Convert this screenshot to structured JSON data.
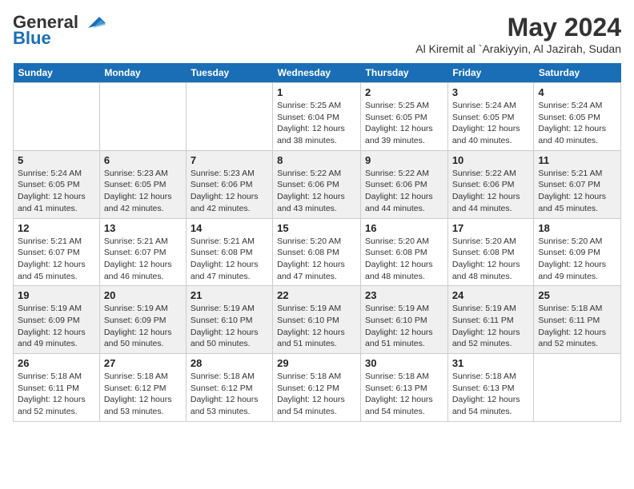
{
  "logo": {
    "line1": "General",
    "line2": "Blue"
  },
  "title": "May 2024",
  "subtitle": "Al Kiremit al `Arakiyyin, Al Jazirah, Sudan",
  "headers": [
    "Sunday",
    "Monday",
    "Tuesday",
    "Wednesday",
    "Thursday",
    "Friday",
    "Saturday"
  ],
  "weeks": [
    [
      {
        "day": "",
        "info": ""
      },
      {
        "day": "",
        "info": ""
      },
      {
        "day": "",
        "info": ""
      },
      {
        "day": "1",
        "info": "Sunrise: 5:25 AM\nSunset: 6:04 PM\nDaylight: 12 hours and 38 minutes."
      },
      {
        "day": "2",
        "info": "Sunrise: 5:25 AM\nSunset: 6:05 PM\nDaylight: 12 hours and 39 minutes."
      },
      {
        "day": "3",
        "info": "Sunrise: 5:24 AM\nSunset: 6:05 PM\nDaylight: 12 hours and 40 minutes."
      },
      {
        "day": "4",
        "info": "Sunrise: 5:24 AM\nSunset: 6:05 PM\nDaylight: 12 hours and 40 minutes."
      }
    ],
    [
      {
        "day": "5",
        "info": "Sunrise: 5:24 AM\nSunset: 6:05 PM\nDaylight: 12 hours and 41 minutes."
      },
      {
        "day": "6",
        "info": "Sunrise: 5:23 AM\nSunset: 6:05 PM\nDaylight: 12 hours and 42 minutes."
      },
      {
        "day": "7",
        "info": "Sunrise: 5:23 AM\nSunset: 6:06 PM\nDaylight: 12 hours and 42 minutes."
      },
      {
        "day": "8",
        "info": "Sunrise: 5:22 AM\nSunset: 6:06 PM\nDaylight: 12 hours and 43 minutes."
      },
      {
        "day": "9",
        "info": "Sunrise: 5:22 AM\nSunset: 6:06 PM\nDaylight: 12 hours and 44 minutes."
      },
      {
        "day": "10",
        "info": "Sunrise: 5:22 AM\nSunset: 6:06 PM\nDaylight: 12 hours and 44 minutes."
      },
      {
        "day": "11",
        "info": "Sunrise: 5:21 AM\nSunset: 6:07 PM\nDaylight: 12 hours and 45 minutes."
      }
    ],
    [
      {
        "day": "12",
        "info": "Sunrise: 5:21 AM\nSunset: 6:07 PM\nDaylight: 12 hours and 45 minutes."
      },
      {
        "day": "13",
        "info": "Sunrise: 5:21 AM\nSunset: 6:07 PM\nDaylight: 12 hours and 46 minutes."
      },
      {
        "day": "14",
        "info": "Sunrise: 5:21 AM\nSunset: 6:08 PM\nDaylight: 12 hours and 47 minutes."
      },
      {
        "day": "15",
        "info": "Sunrise: 5:20 AM\nSunset: 6:08 PM\nDaylight: 12 hours and 47 minutes."
      },
      {
        "day": "16",
        "info": "Sunrise: 5:20 AM\nSunset: 6:08 PM\nDaylight: 12 hours and 48 minutes."
      },
      {
        "day": "17",
        "info": "Sunrise: 5:20 AM\nSunset: 6:08 PM\nDaylight: 12 hours and 48 minutes."
      },
      {
        "day": "18",
        "info": "Sunrise: 5:20 AM\nSunset: 6:09 PM\nDaylight: 12 hours and 49 minutes."
      }
    ],
    [
      {
        "day": "19",
        "info": "Sunrise: 5:19 AM\nSunset: 6:09 PM\nDaylight: 12 hours and 49 minutes."
      },
      {
        "day": "20",
        "info": "Sunrise: 5:19 AM\nSunset: 6:09 PM\nDaylight: 12 hours and 50 minutes."
      },
      {
        "day": "21",
        "info": "Sunrise: 5:19 AM\nSunset: 6:10 PM\nDaylight: 12 hours and 50 minutes."
      },
      {
        "day": "22",
        "info": "Sunrise: 5:19 AM\nSunset: 6:10 PM\nDaylight: 12 hours and 51 minutes."
      },
      {
        "day": "23",
        "info": "Sunrise: 5:19 AM\nSunset: 6:10 PM\nDaylight: 12 hours and 51 minutes."
      },
      {
        "day": "24",
        "info": "Sunrise: 5:19 AM\nSunset: 6:11 PM\nDaylight: 12 hours and 52 minutes."
      },
      {
        "day": "25",
        "info": "Sunrise: 5:18 AM\nSunset: 6:11 PM\nDaylight: 12 hours and 52 minutes."
      }
    ],
    [
      {
        "day": "26",
        "info": "Sunrise: 5:18 AM\nSunset: 6:11 PM\nDaylight: 12 hours and 52 minutes."
      },
      {
        "day": "27",
        "info": "Sunrise: 5:18 AM\nSunset: 6:12 PM\nDaylight: 12 hours and 53 minutes."
      },
      {
        "day": "28",
        "info": "Sunrise: 5:18 AM\nSunset: 6:12 PM\nDaylight: 12 hours and 53 minutes."
      },
      {
        "day": "29",
        "info": "Sunrise: 5:18 AM\nSunset: 6:12 PM\nDaylight: 12 hours and 54 minutes."
      },
      {
        "day": "30",
        "info": "Sunrise: 5:18 AM\nSunset: 6:13 PM\nDaylight: 12 hours and 54 minutes."
      },
      {
        "day": "31",
        "info": "Sunrise: 5:18 AM\nSunset: 6:13 PM\nDaylight: 12 hours and 54 minutes."
      },
      {
        "day": "",
        "info": ""
      }
    ]
  ],
  "row_shading": [
    false,
    true,
    false,
    true,
    false
  ]
}
